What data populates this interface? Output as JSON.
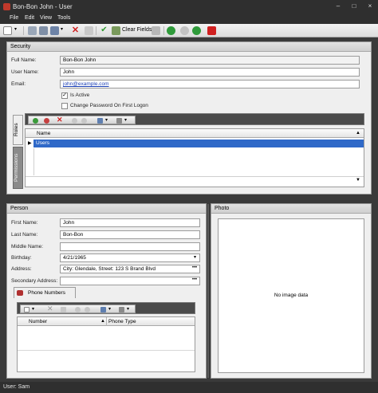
{
  "window": {
    "title": "Bon-Bon John - User",
    "min_glyph": "–",
    "max_glyph": "□",
    "close_glyph": "×"
  },
  "menu": [
    "File",
    "Edit",
    "View",
    "Tools"
  ],
  "toolbar": {
    "clear_fields_label": "Clear Fields"
  },
  "security": {
    "header": "Security",
    "full_name_label": "Full Name:",
    "full_name_value": "Bon-Bon John",
    "user_name_label": "User Name:",
    "user_name_value": "John",
    "email_label": "Email:",
    "email_value": "john@example.com",
    "is_active_label": "Is Active",
    "is_active_checked": true,
    "change_password_label": "Change Password On First Logon",
    "change_password_checked": false,
    "tabs": [
      "Roles",
      "Permissions"
    ],
    "roles_grid": {
      "column": "Name",
      "rows": [
        "Users"
      ]
    }
  },
  "person": {
    "header": "Person",
    "first_name_label": "First Name:",
    "first_name_value": "John",
    "last_name_label": "Last Name:",
    "last_name_value": "Bon-Bon",
    "middle_name_label": "Middle Name:",
    "middle_name_value": "",
    "birthday_label": "Birthday:",
    "birthday_value": "4/21/1965",
    "address_label": "Address:",
    "address_value": "City: Glendale, Street: 123 S Brand Blvd",
    "secondary_address_label": "Secondary Address:",
    "secondary_address_value": "",
    "phone_tab_label": "Phone Numbers",
    "phone_grid": {
      "columns": [
        "Number",
        "Phone Type"
      ]
    }
  },
  "photo": {
    "header": "Photo",
    "empty_text": "No image data"
  },
  "status": {
    "user_text": "User: Sam"
  },
  "colors": {
    "selection": "#2f69c8",
    "dark_chrome": "#2f2f2f",
    "panel_bg": "#efefef"
  }
}
